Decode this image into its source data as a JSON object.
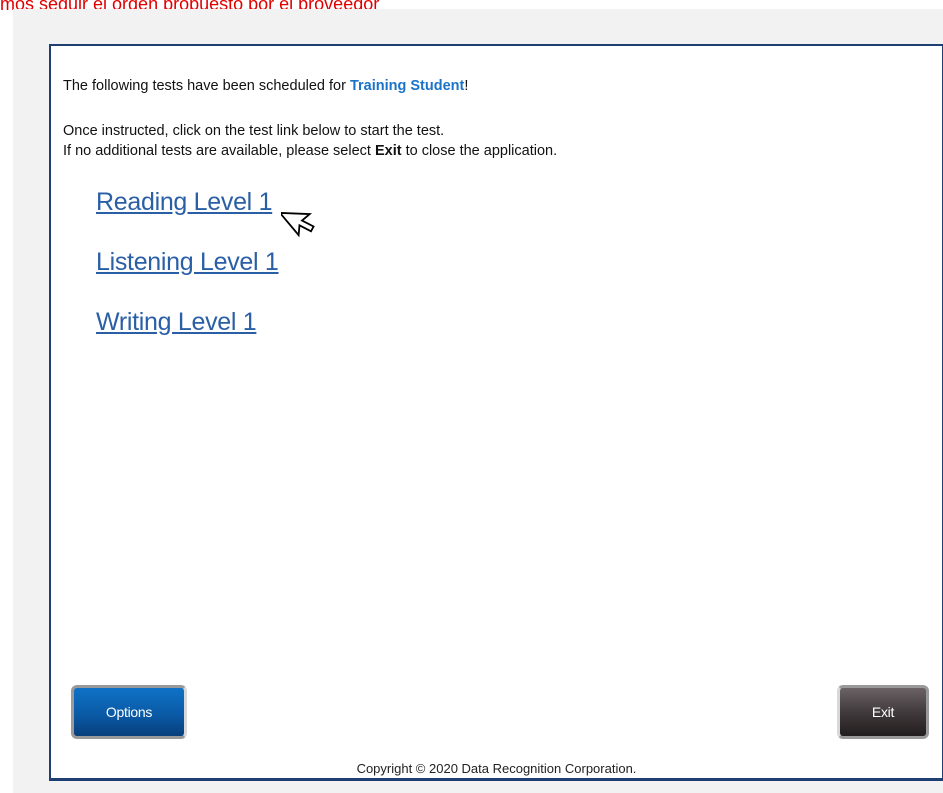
{
  "top_note": "mos seguir el orden propuesto por el proveedor",
  "header": {
    "intro_prefix": "The following tests have been scheduled for ",
    "student_name": "Training Student",
    "intro_suffix": "!",
    "instruction_1": "Once instructed, click on the test link below to start the test.",
    "instruction_2_prefix": "If no additional tests are available, please select ",
    "instruction_2_bold": "Exit",
    "instruction_2_suffix": " to close the application."
  },
  "tests": [
    {
      "label": "Reading Level 1"
    },
    {
      "label": "Listening Level 1"
    },
    {
      "label": "Writing Level 1"
    }
  ],
  "buttons": {
    "options_label": "Options",
    "exit_label": "Exit"
  },
  "footer": {
    "copyright": "Copyright © 2020 Data Recognition Corporation."
  },
  "colors": {
    "panel_border": "#1f3f73",
    "link": "#2a5fa6",
    "student_name": "#1a73c8",
    "top_note": "#e00000"
  },
  "icons": {
    "cursor": "mouse-pointer-icon"
  }
}
